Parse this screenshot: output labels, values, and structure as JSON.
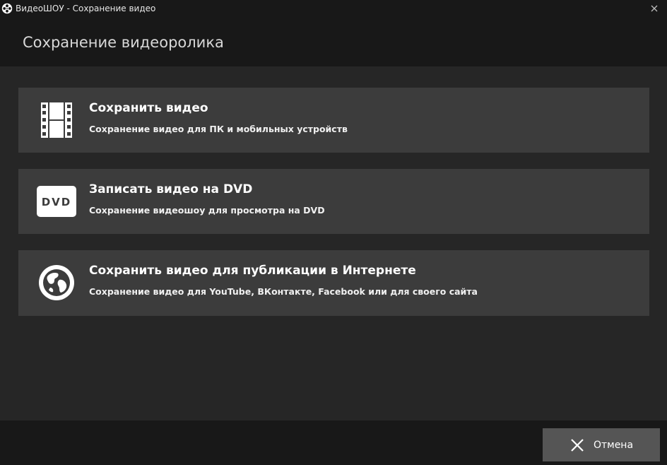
{
  "window": {
    "title": "ВидеоШОУ - Сохранение видео",
    "close_glyph": "✕"
  },
  "header": {
    "title": "Сохранение видеоролика"
  },
  "options": [
    {
      "icon": "film-strip-icon",
      "title": "Сохранить видео",
      "description": "Сохранение видео для ПК и мобильных устройств"
    },
    {
      "icon": "dvd-icon",
      "icon_text": "DVD",
      "title": "Записать видео на DVD",
      "description": "Сохранение видеошоу для просмотра на DVD"
    },
    {
      "icon": "globe-icon",
      "title": "Сохранить видео для публикации в Интернете",
      "description": "Сохранение видео для YouTube, ВКонтакте, Facebook или для своего сайта"
    }
  ],
  "footer": {
    "cancel_label": "Отмена"
  },
  "colors": {
    "titlebar_bg": "#181818",
    "body_bg": "#262626",
    "option_bg": "#3c3c3c",
    "button_bg": "#555555",
    "text": "#ffffff"
  }
}
